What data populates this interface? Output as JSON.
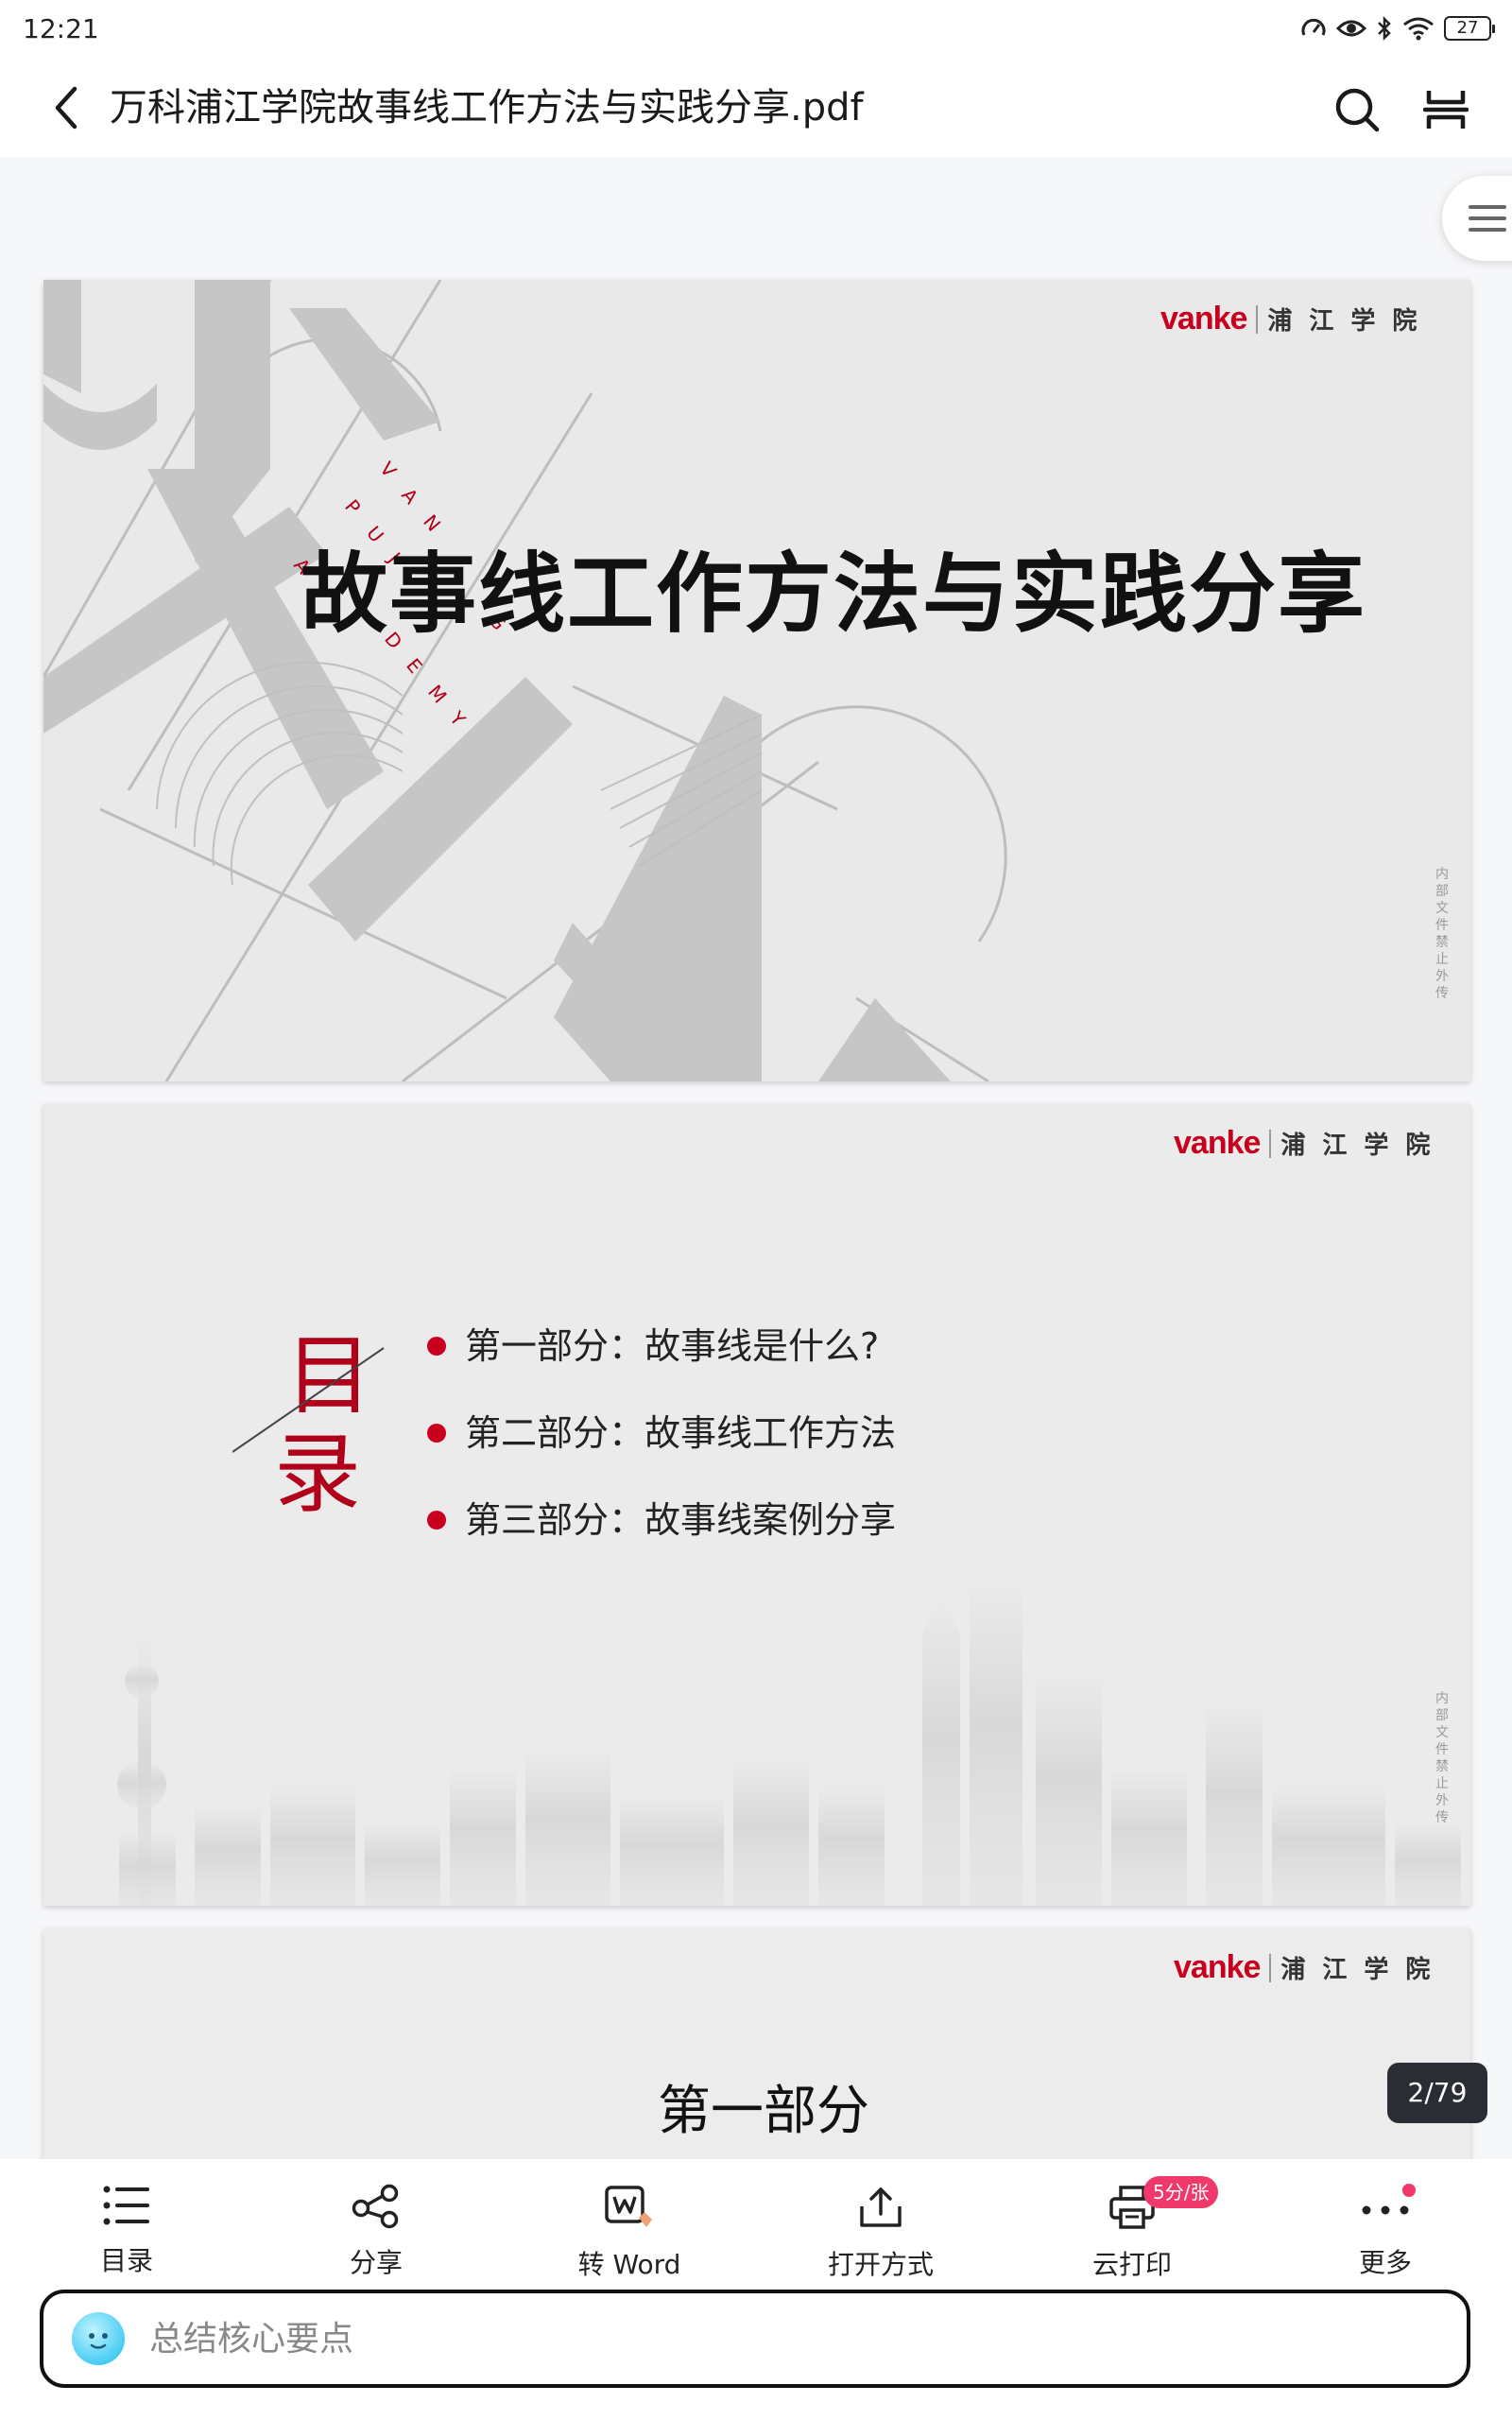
{
  "status_bar": {
    "time": "12:21",
    "battery": "27"
  },
  "top_bar": {
    "title": "万科浦江学院故事线工作方法与实践分享.pdf"
  },
  "slides": {
    "brand_vanke": "vanke",
    "brand_academy": "浦江学院",
    "side_note": "内部文件禁止外传",
    "slide1": {
      "title": "故事线工作方法与实践分享",
      "academy_letters": "VANKE PUJIANG ACADEMY"
    },
    "slide2": {
      "toc_char1": "目",
      "toc_char2": "录",
      "items": [
        "第一部分：故事线是什么?",
        "第二部分：故事线工作方法",
        "第三部分：故事线案例分享"
      ]
    },
    "slide3": {
      "title": "第一部分"
    }
  },
  "page_indicator": "2/79",
  "toolbar": {
    "items": [
      {
        "label": "目录",
        "icon": "list-icon"
      },
      {
        "label": "分享",
        "icon": "share-icon"
      },
      {
        "label": "转 Word",
        "icon": "word-convert-icon"
      },
      {
        "label": "打开方式",
        "icon": "open-with-icon"
      },
      {
        "label": "云打印",
        "icon": "print-icon",
        "badge": "5分/张"
      },
      {
        "label": "更多",
        "icon": "more-icon"
      }
    ]
  },
  "ai_input": {
    "placeholder": "总结核心要点"
  },
  "colors": {
    "brand_red": "#c8001e",
    "badge_pink": "#f0386b",
    "page_badge": "#2a2d33"
  }
}
